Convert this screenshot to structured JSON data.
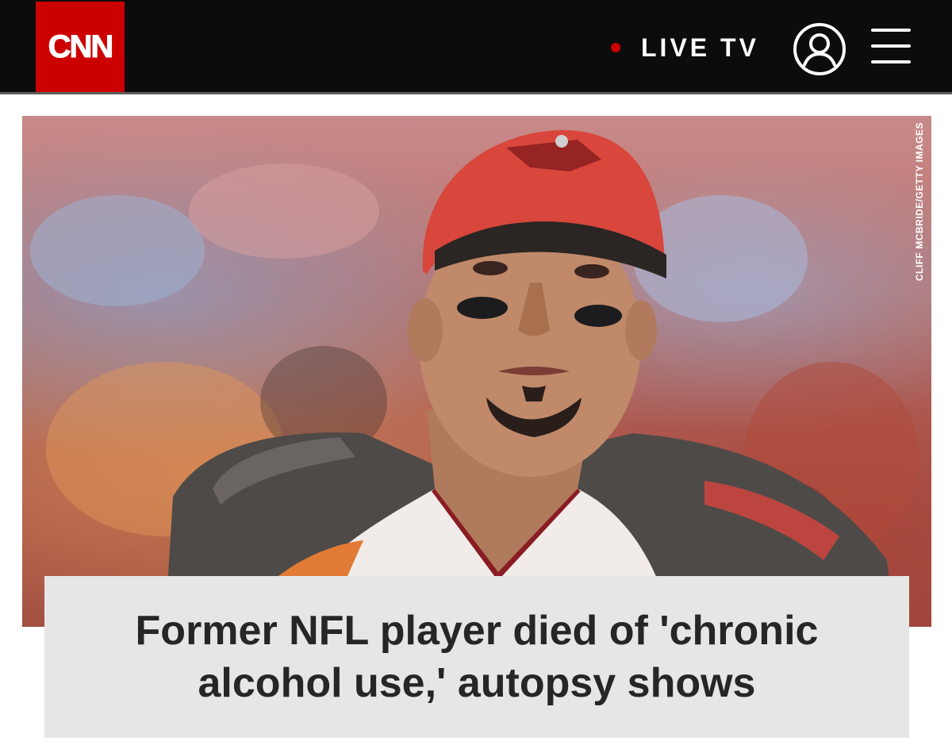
{
  "header": {
    "logo_text": "CNN",
    "live_label": "LIVE TV",
    "icons": {
      "account": "account-icon",
      "menu": "hamburger-menu-icon",
      "live_dot": "live-dot-icon"
    },
    "colors": {
      "background": "#0c0c0c",
      "brand_red": "#cc0000",
      "text": "#ffffff"
    }
  },
  "article": {
    "photo_credit": "CLIFF MCBRIDE/GETTY IMAGES",
    "headline": "Former NFL player died of 'chronic alcohol use,' autopsy shows",
    "colors": {
      "headline_bg": "#e6e6e6",
      "headline_text": "#262626"
    }
  }
}
